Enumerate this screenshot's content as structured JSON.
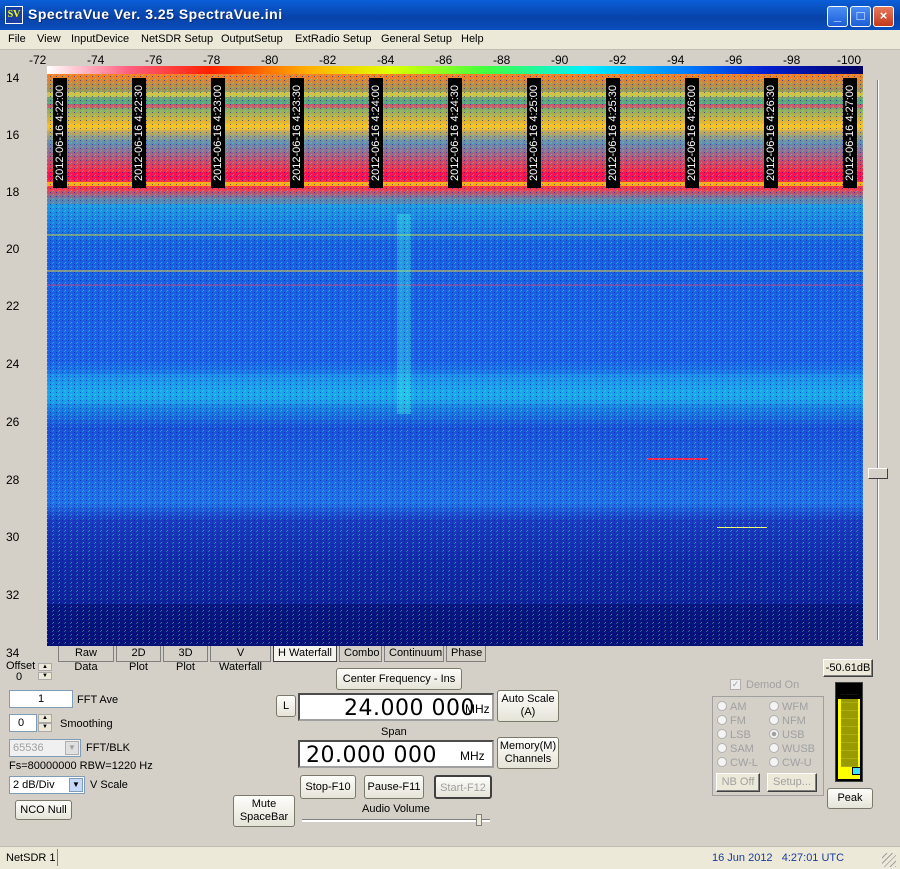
{
  "window": {
    "title": "SpectraVue Ver. 3.25  SpectraVue.ini",
    "icon_text": "SV",
    "controls": [
      "_",
      "□",
      "×"
    ]
  },
  "menu": [
    "File",
    "View",
    "InputDevice",
    "NetSDR Setup",
    "OutputSetup",
    "ExtRadio Setup",
    "General Setup",
    "Help"
  ],
  "x_axis_ticks": [
    "-72",
    "-74",
    "-76",
    "-78",
    "-80",
    "-82",
    "-84",
    "-86",
    "-88",
    "-90",
    "-92",
    "-94",
    "-96",
    "-98",
    "-100"
  ],
  "y_axis_ticks": [
    "14",
    "16",
    "18",
    "20",
    "22",
    "24",
    "26",
    "28",
    "30",
    "32",
    "34"
  ],
  "waterfall": {
    "time_labels": [
      "2012-06-16 4:22:00",
      "2012-06-16 4:22:30",
      "2012-06-16 4:23:00",
      "2012-06-16 4:23:30",
      "2012-06-16 4:24:00",
      "2012-06-16 4:24:30",
      "2012-06-16 4:25:00",
      "2012-06-16 4:25:30",
      "2012-06-16 4:26:00",
      "2012-06-16 4:26:30",
      "2012-06-16 4:27:00"
    ],
    "colors": {
      "background": "#1838c8",
      "hot": "#ff2060",
      "warm": "#ffd000",
      "cool": "#00e0ff"
    }
  },
  "tabs": [
    {
      "label": "Raw Data",
      "active": false
    },
    {
      "label": "2D Plot",
      "active": false
    },
    {
      "label": "3D Plot",
      "active": false
    },
    {
      "label": "V Waterfall",
      "active": false
    },
    {
      "label": "H Waterfall",
      "active": true
    },
    {
      "label": "Combo",
      "active": false
    },
    {
      "label": "Continuum",
      "active": false
    },
    {
      "label": "Phase",
      "active": false
    }
  ],
  "left_panel": {
    "offset_label": "Offset",
    "offset_value": "0",
    "fft_ave_value": "1",
    "fft_ave_label": "FFT Ave",
    "smoothing_value": "0",
    "smoothing_label": "Smoothing",
    "fft_blk_value": "65536",
    "fft_blk_label": "FFT/BLK",
    "fs_rbw": "Fs=80000000 RBW=1220 Hz",
    "vscale_value": "2 dB/Div",
    "vscale_label": "V Scale",
    "nco_null": "NCO Null"
  },
  "center": {
    "center_freq_button": "Center Frequency - Ins",
    "l_button": "L",
    "center_value": "24.000 000",
    "center_unit": "MHz",
    "span_label": "Span",
    "span_value": "20.000 000",
    "span_unit": "MHz",
    "auto_scale": "Auto Scale (A)",
    "memory_channels": "Memory(M) Channels",
    "stop": "Stop-F10",
    "pause": "Pause-F11",
    "start": "Start-F12",
    "mute": "Mute SpaceBar",
    "audio_volume_label": "Audio Volume"
  },
  "demod": {
    "demod_on_label": "Demod On",
    "modes_left": [
      "AM",
      "FM",
      "LSB",
      "SAM",
      "CW-L"
    ],
    "modes_right": [
      "WFM",
      "NFM",
      "USB",
      "WUSB",
      "CW-U"
    ],
    "selected": "USB",
    "nb_off": "NB Off",
    "setup": "Setup..."
  },
  "meter": {
    "level_text": "-50.61dB",
    "level_fraction": 0.85,
    "peak_button": "Peak"
  },
  "status": {
    "device": "NetSDR 1",
    "datetime": "16 Jun 2012   4:27:01 UTC"
  }
}
